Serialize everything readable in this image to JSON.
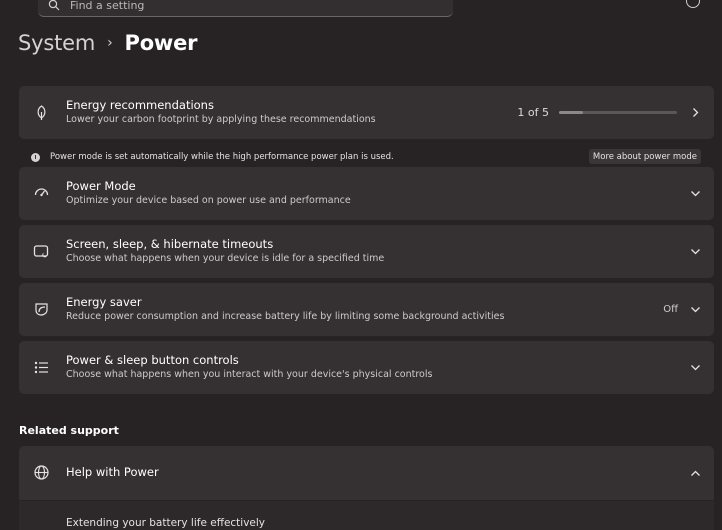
{
  "search": {
    "placeholder": "Find a setting"
  },
  "breadcrumb": {
    "parent": "System",
    "separator": "›",
    "current": "Power"
  },
  "energy_recommendations": {
    "title": "Energy recommendations",
    "description": "Lower your carbon footprint by applying these recommendations",
    "progress_label": "1 of 5",
    "progress_fraction": 0.2
  },
  "info": {
    "message": "Power mode is set automatically while the high performance power plan is used.",
    "link": "More about power mode"
  },
  "power_mode": {
    "title": "Power Mode",
    "description": "Optimize your device based on power use and performance"
  },
  "screen_sleep": {
    "title": "Screen, sleep, & hibernate timeouts",
    "description": "Choose what happens when your device is idle for a specified time"
  },
  "energy_saver": {
    "title": "Energy saver",
    "description": "Reduce power consumption and increase battery life by limiting some background activities",
    "status": "Off"
  },
  "button_controls": {
    "title": "Power & sleep button controls",
    "description": "Choose what happens when you interact with your device's physical controls"
  },
  "related_support": {
    "title": "Related support",
    "help_title": "Help with Power",
    "links": [
      "Extending your battery life effectively"
    ]
  },
  "colors": {
    "background": "#272223",
    "card": "#353031",
    "text": "#ffffff",
    "secondary_text": "#cfcbcc"
  }
}
